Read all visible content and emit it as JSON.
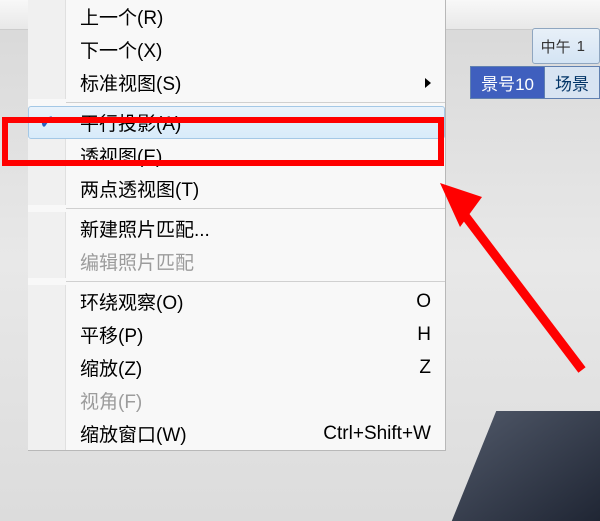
{
  "toolbar": {
    "time_label": "中午",
    "time_value": "1"
  },
  "tabs": {
    "items": [
      {
        "label": "号"
      },
      {
        "active_label": "景号10"
      },
      {
        "label": "场景"
      }
    ]
  },
  "menu": {
    "items": [
      {
        "label": "上一个(R)"
      },
      {
        "label": "下一个(X)"
      },
      {
        "label": "标准视图(S)",
        "submenu": true
      }
    ],
    "proj": [
      {
        "label": "平行投影(A)",
        "checked": true,
        "highlighted": true
      },
      {
        "label": "透视图(E)"
      },
      {
        "label": "两点透视图(T)"
      }
    ],
    "photo": [
      {
        "label": "新建照片匹配..."
      },
      {
        "label": "编辑照片匹配",
        "disabled": true
      }
    ],
    "nav": [
      {
        "label": "环绕观察(O)",
        "shortcut": "O"
      },
      {
        "label": "平移(P)",
        "shortcut": "H"
      },
      {
        "label": "缩放(Z)",
        "shortcut": "Z"
      },
      {
        "label": "视角(F)",
        "disabled": true
      },
      {
        "label": "缩放窗口(W)",
        "shortcut": "Ctrl+Shift+W"
      }
    ]
  },
  "annotation": {
    "arrow_color": "#ff0000",
    "box_color": "#ff0000"
  }
}
